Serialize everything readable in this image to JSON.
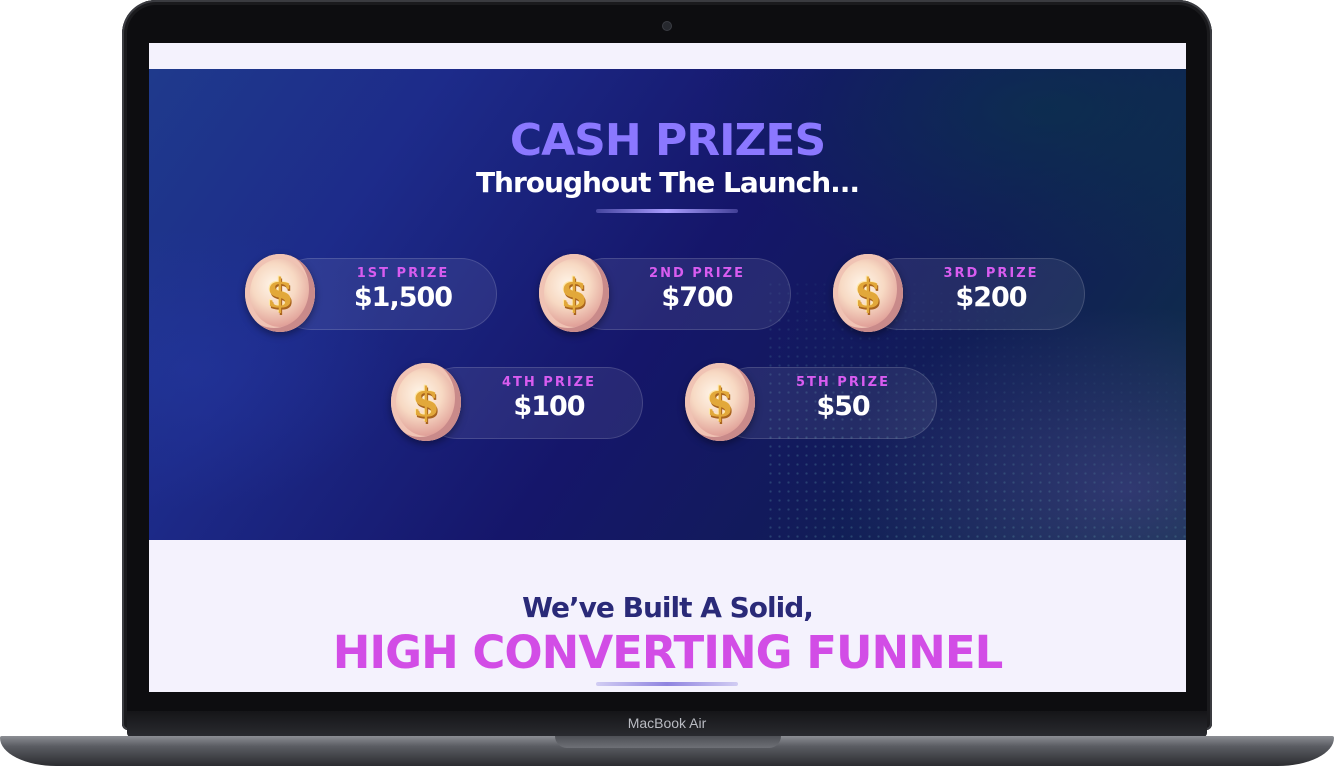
{
  "hero": {
    "title": "CASH PRIZES",
    "subtitle": "Throughout The Launch..."
  },
  "prizes": [
    {
      "label": "1ST PRIZE",
      "amount": "$1,500",
      "icon": "dollar-coin-icon"
    },
    {
      "label": "2ND PRIZE",
      "amount": "$700",
      "icon": "dollar-coin-icon"
    },
    {
      "label": "3RD PRIZE",
      "amount": "$200",
      "icon": "dollar-coin-icon"
    },
    {
      "label": "4TH PRIZE",
      "amount": "$100",
      "icon": "dollar-coin-icon"
    },
    {
      "label": "5TH PRIZE",
      "amount": "$50",
      "icon": "dollar-coin-icon"
    }
  ],
  "coin_symbol": "$",
  "funnel": {
    "subtitle": "We’ve Built A Solid,",
    "title": "HIGH CONVERTING FUNNEL"
  },
  "device": {
    "model": "MacBook Air"
  },
  "colors": {
    "accent_purple": "#8b78ff",
    "prize_label": "#d85cf0",
    "funnel_title": "#d24de6",
    "funnel_subtitle": "#2a2a78"
  }
}
